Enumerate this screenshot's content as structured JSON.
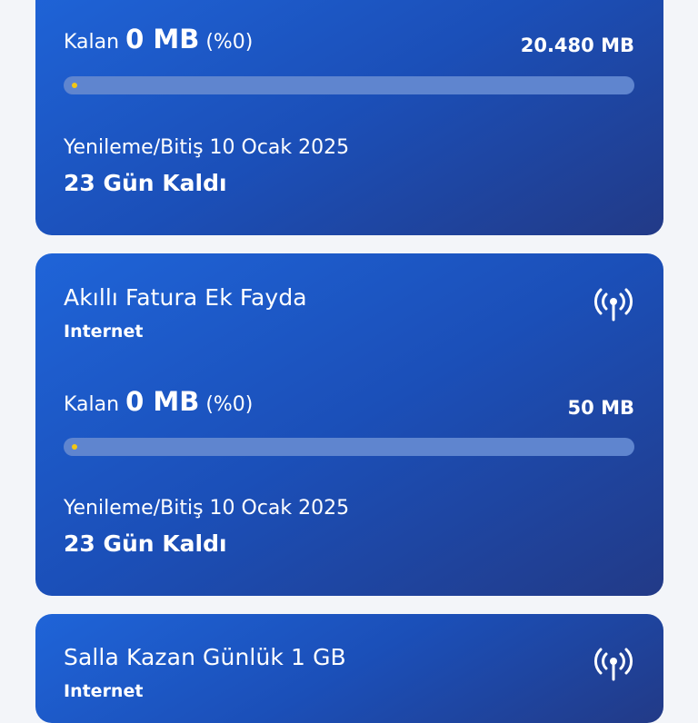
{
  "cards": [
    {
      "remaining_label": "Kalan",
      "remaining_value": "0 MB",
      "remaining_percent": "(%0)",
      "total": "20.480 MB",
      "usage_fraction": 0,
      "renewal_text": "Yenileme/Bitiş 10 Ocak 2025",
      "days_left": "23 Gün Kaldı"
    },
    {
      "title": "Akıllı Fatura Ek Fayda",
      "type": "Internet",
      "icon": "antenna-signal-icon",
      "remaining_label": "Kalan",
      "remaining_value": "0 MB",
      "remaining_percent": "(%0)",
      "total": "50 MB",
      "usage_fraction": 0,
      "renewal_text": "Yenileme/Bitiş 10 Ocak 2025",
      "days_left": "23 Gün Kaldı"
    },
    {
      "title": "Salla Kazan Günlük 1 GB",
      "type": "Internet",
      "icon": "antenna-signal-icon"
    }
  ],
  "colors": {
    "card_gradient_start": "#1f64d8",
    "card_gradient_end": "#223a87",
    "bar_track": "#5f85cf",
    "bar_indicator": "#f2c714",
    "background": "#f3f5f9"
  }
}
